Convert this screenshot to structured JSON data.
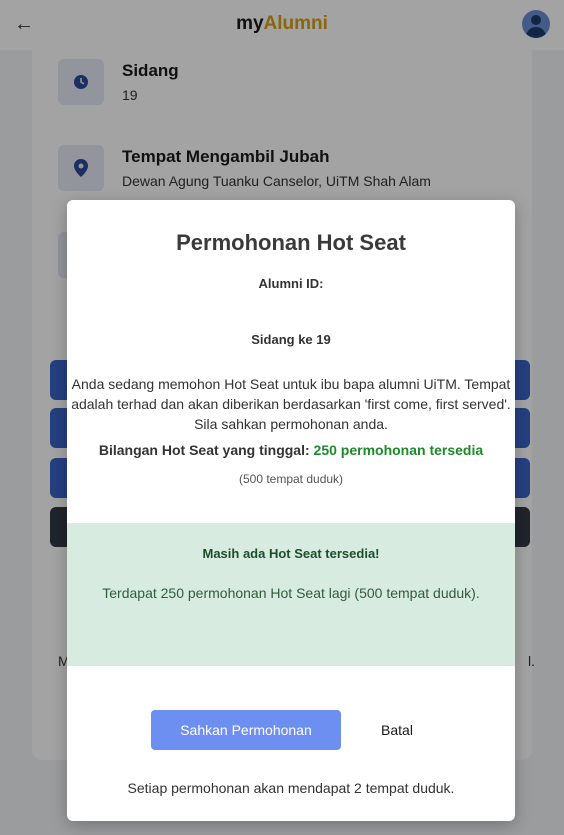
{
  "header": {
    "back_icon": "arrow-left-icon",
    "brand_prefix": "my",
    "brand_suffix": "Alumni",
    "avatar_icon": "user-avatar-icon",
    "colors": {
      "prefix": "#1a1a1a",
      "suffix": "#d4a017"
    }
  },
  "info": [
    {
      "icon": "clock-icon",
      "title": "Sidang",
      "value": "19"
    },
    {
      "icon": "location-pin-icon",
      "title": "Tempat Mengambil Jubah",
      "value": "Dewan Agung Tuanku Canselor, UiTM Shah Alam"
    }
  ],
  "modal": {
    "title": "Permohonan Hot Seat",
    "alumni_id_label": "Alumni ID:",
    "sidang": "Sidang ke 19",
    "description": "Anda sedang memohon Hot Seat untuk ibu bapa alumni UiTM. Tempat adalah terhad dan akan diberikan berdasarkan 'first come, first served'. Sila sahkan permohonan anda.",
    "remaining_label": "Bilangan Hot Seat yang tinggal:",
    "remaining_value": "250 permohonan tersedia",
    "capacity": "(500 tempat duduk)",
    "availability": {
      "title": "Masih ada Hot Seat tersedia!",
      "text": "Terdapat 250 permohonan Hot Seat lagi (500 tempat duduk)."
    },
    "confirm_label": "Sahkan Permohonan",
    "cancel_label": "Batal",
    "footer": "Setiap permohonan akan mendapat 2 tempat duduk."
  },
  "background": {
    "note_left": "M",
    "note_right": "l."
  },
  "colors": {
    "accent": "#6d8ff2",
    "available_bg": "#d8ebe0",
    "remaining_green": "#1c8a2a"
  }
}
